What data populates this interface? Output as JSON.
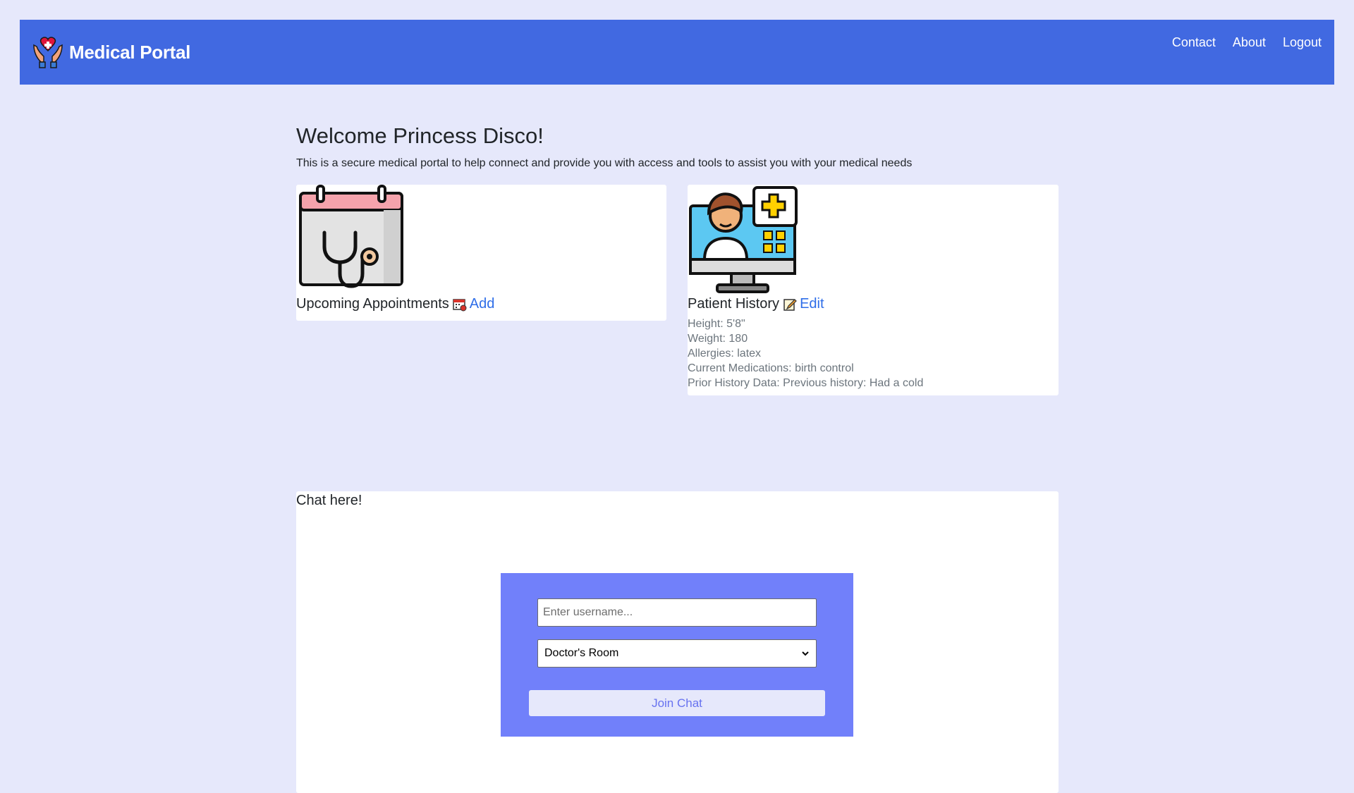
{
  "nav": {
    "brand": "Medical Portal",
    "links": [
      "Contact",
      "About",
      "Logout"
    ]
  },
  "main": {
    "welcome": "Welcome Princess Disco!",
    "intro": "This is a secure medical portal to help connect and provide you with access and tools to assist you with your medical needs"
  },
  "appointments": {
    "title": "Upcoming Appointments",
    "link": "Add"
  },
  "history": {
    "title": "Patient History",
    "link": "Edit",
    "lines": [
      "Height: 5'8\"",
      "Weight: 180",
      "Allergies: latex",
      "Current Medications: birth control",
      "Prior History Data: Previous history: Had a cold"
    ]
  },
  "chat": {
    "title": "Chat here!",
    "username_placeholder": "Enter username...",
    "room_selected": "Doctor's Room",
    "join_label": "Join Chat"
  },
  "colors": {
    "page_bg": "#e6e8fb",
    "navbar": "#4169e1",
    "link": "#2f6ee8",
    "join_box": "#7180fa"
  },
  "icons": {
    "logo": "heart-in-hands-icon",
    "appointments": "calendar-stethoscope-icon",
    "history": "doctor-monitor-icon",
    "add": "calendar-small-icon",
    "edit": "pencil-note-icon"
  }
}
